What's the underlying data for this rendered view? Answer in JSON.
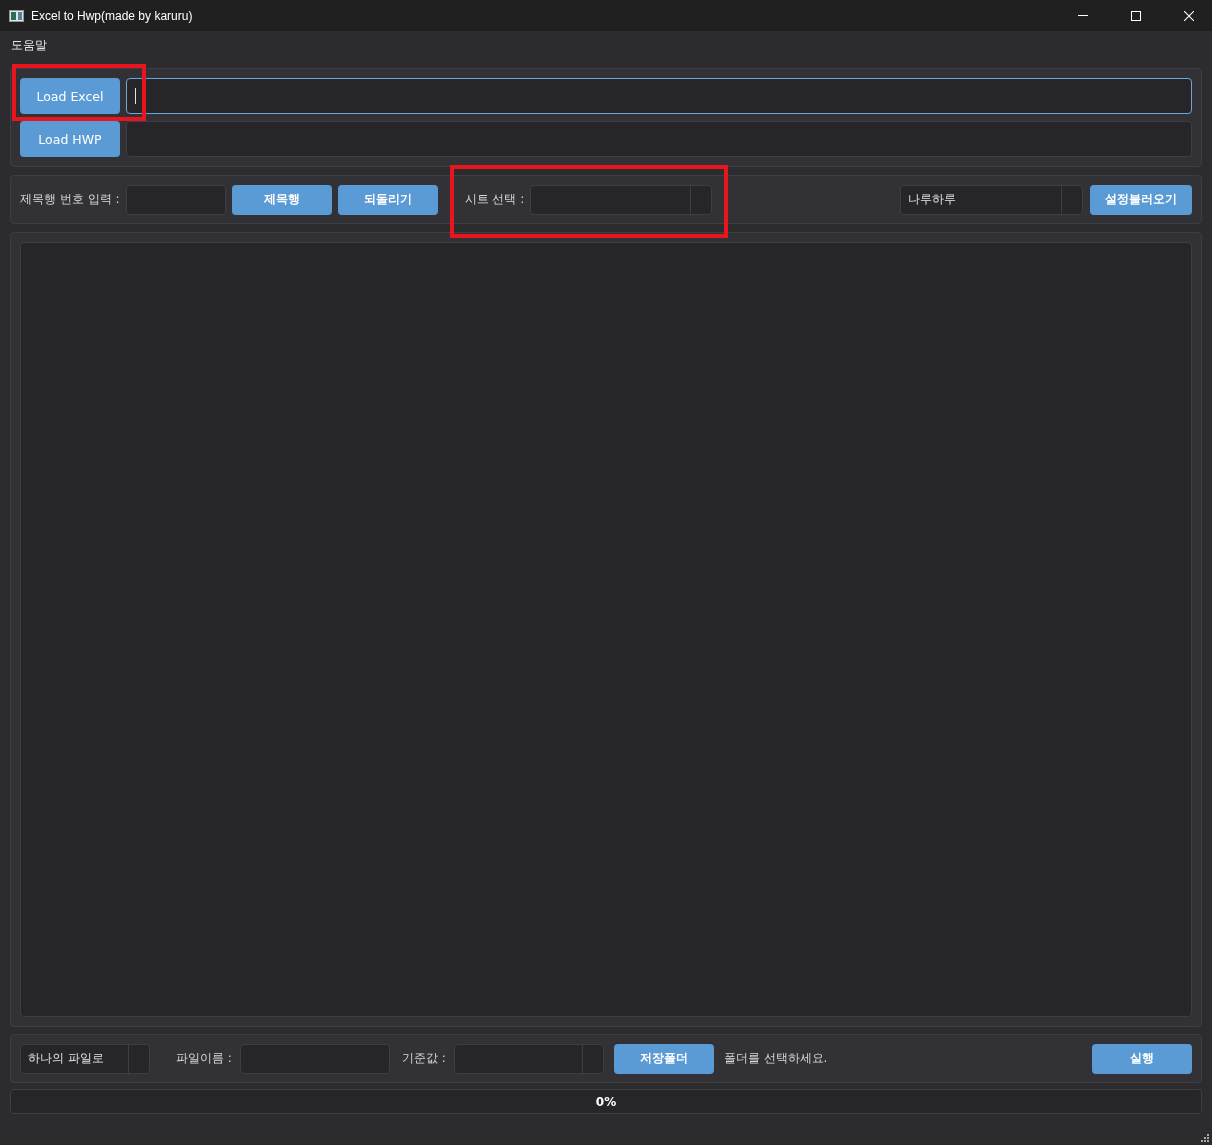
{
  "window": {
    "title": "Excel to Hwp(made by karuru)"
  },
  "menu": [
    "도움말"
  ],
  "file_rows": [
    {
      "button": "Load Excel",
      "focused": true
    },
    {
      "button": "Load HWP",
      "focused": false
    }
  ],
  "header_row": {
    "label": "제목행 번호 입력 :",
    "buttons": [
      "제목행",
      "되돌리기"
    ],
    "sheet_label": "시트 선택 :",
    "preset": "나루하루",
    "load_settings": "설정불러오기"
  },
  "bottom": {
    "mode": "하나의 파일로",
    "filename_label": "파일이름 :",
    "key_label": "기준값 :",
    "folder_button": "저장폴더",
    "folder_hint": "폴더를 선택하세요.",
    "run_button": "실행"
  },
  "progress": {
    "level": 0,
    "reading": "0%"
  }
}
